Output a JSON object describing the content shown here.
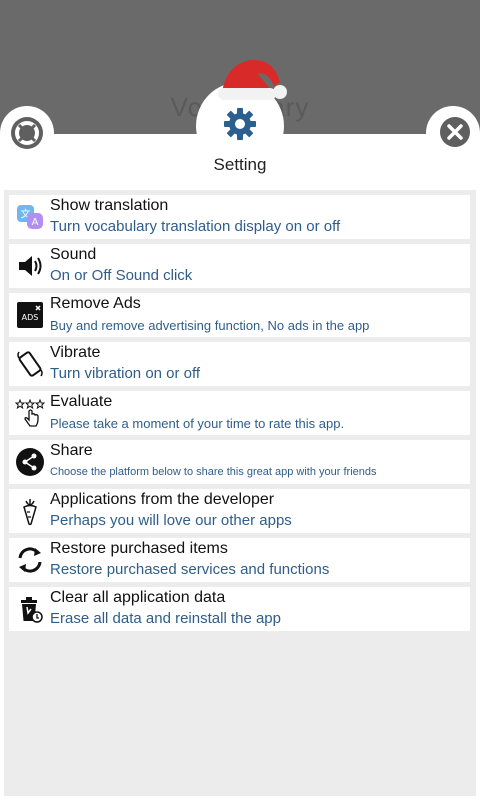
{
  "background": {
    "title": "Vocabulary"
  },
  "header": {
    "title": "Setting"
  },
  "items": [
    {
      "title": "Show translation",
      "subtitle": "Turn vocabulary translation display on or off",
      "icon": "translate-icon"
    },
    {
      "title": "Sound",
      "subtitle": "On or Off Sound click",
      "icon": "speaker-icon"
    },
    {
      "title": "Remove Ads",
      "subtitle": "Buy and remove advertising function, No ads in the app",
      "icon": "ads-icon",
      "icon_text": "ADS"
    },
    {
      "title": "Vibrate",
      "subtitle": "Turn vibration on or off",
      "icon": "vibrate-icon"
    },
    {
      "title": "Evaluate",
      "subtitle": "Please take a moment of your time to rate this app.",
      "icon": "rate-stars-icon"
    },
    {
      "title": "Share",
      "subtitle": "Choose the platform below to share this great app with your friends",
      "icon": "share-icon"
    },
    {
      "title": "Applications from the developer",
      "subtitle": "Perhaps you will love our other apps",
      "icon": "carrot-icon"
    },
    {
      "title": "Restore purchased items",
      "subtitle": "Restore purchased services and functions",
      "icon": "restore-icon"
    },
    {
      "title": "Clear all application data",
      "subtitle": "Erase all data and reinstall the app",
      "icon": "trash-icon"
    }
  ],
  "colors": {
    "subtitle": "#2f5d8a",
    "list_bg": "#ececec",
    "backdrop": "#6a6a6a",
    "accent": "#2b5f8f",
    "hat_red": "#d92a2a"
  }
}
